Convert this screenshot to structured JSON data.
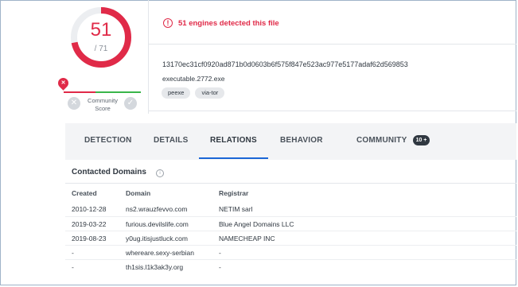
{
  "score": {
    "detected": "51",
    "total": "/ 71",
    "detected_count": 51,
    "total_count": 71,
    "community_label_1": "Community",
    "community_label_2": "Score",
    "marker_glyph": "✕",
    "down_glyph": "✕",
    "up_glyph": "✓"
  },
  "alert": {
    "icon": "!",
    "text": "51 engines detected this file"
  },
  "file": {
    "hash": "13170ec31cf0920ad871b0d0603b6f575f847e523ac977e5177adaf62d569853",
    "name": "executable.2772.exe",
    "tags": [
      "peexe",
      "via-tor"
    ]
  },
  "tabs": [
    {
      "label": "DETECTION"
    },
    {
      "label": "DETAILS"
    },
    {
      "label": "RELATIONS"
    },
    {
      "label": "BEHAVIOR"
    },
    {
      "label": "COMMUNITY"
    }
  ],
  "community_badge": "10 +",
  "section": {
    "title": "Contacted Domains",
    "info_icon": "i"
  },
  "table": {
    "headers": [
      "Created",
      "Domain",
      "Registrar"
    ],
    "rows": [
      [
        "2010-12-28",
        "ns2.wrauzfevvo.com",
        "NETIM sarl"
      ],
      [
        "2019-03-22",
        "furious.devilslife.com",
        "Blue Angel Domains LLC"
      ],
      [
        "2019-08-23",
        "y0ug.itisjustluck.com",
        "NAMECHEAP INC"
      ],
      [
        "-",
        "whereare.sexy-serbian",
        "-"
      ],
      [
        "-",
        "th1sis.l1k3ak3y.org",
        "-"
      ]
    ]
  },
  "colors": {
    "accent_red": "#e02a48",
    "tab_underline": "#1a66d6",
    "community_green": "#39b54a"
  }
}
